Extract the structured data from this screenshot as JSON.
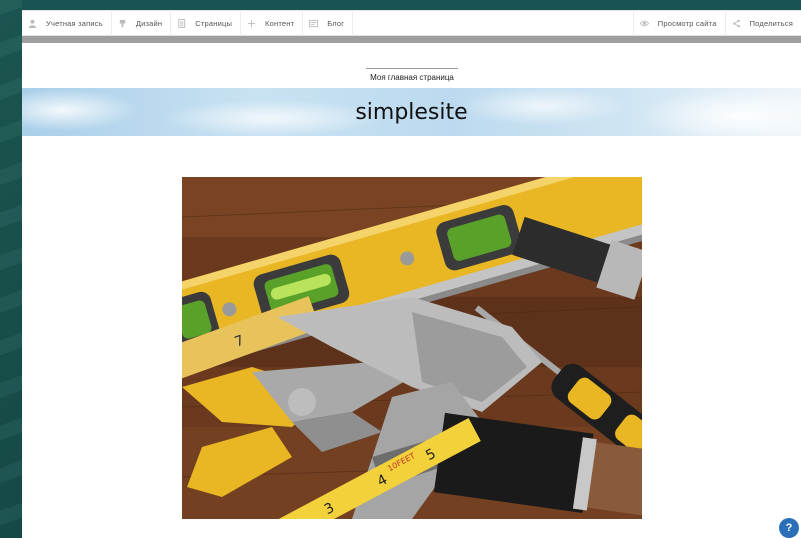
{
  "toolbar": {
    "left_items": [
      {
        "label": "Учетная запись",
        "icon": "user-icon"
      },
      {
        "label": "Дизайн",
        "icon": "brush-icon"
      },
      {
        "label": "Страницы",
        "icon": "page-icon"
      },
      {
        "label": "Контент",
        "icon": "plus-icon"
      },
      {
        "label": "Блог",
        "icon": "blog-icon"
      }
    ],
    "right_items": [
      {
        "label": "Просмотр сайта",
        "icon": "eye-icon"
      },
      {
        "label": "Поделиться",
        "icon": "share-icon"
      }
    ]
  },
  "page": {
    "nav_label": "Моя главная страница",
    "site_title": "simplesite",
    "hero_image": "tools-photo"
  },
  "help": {
    "label": "?"
  },
  "colors": {
    "accent": "#2b6fb8",
    "background": "#17504c",
    "tool_yellow": "#e9b624"
  }
}
